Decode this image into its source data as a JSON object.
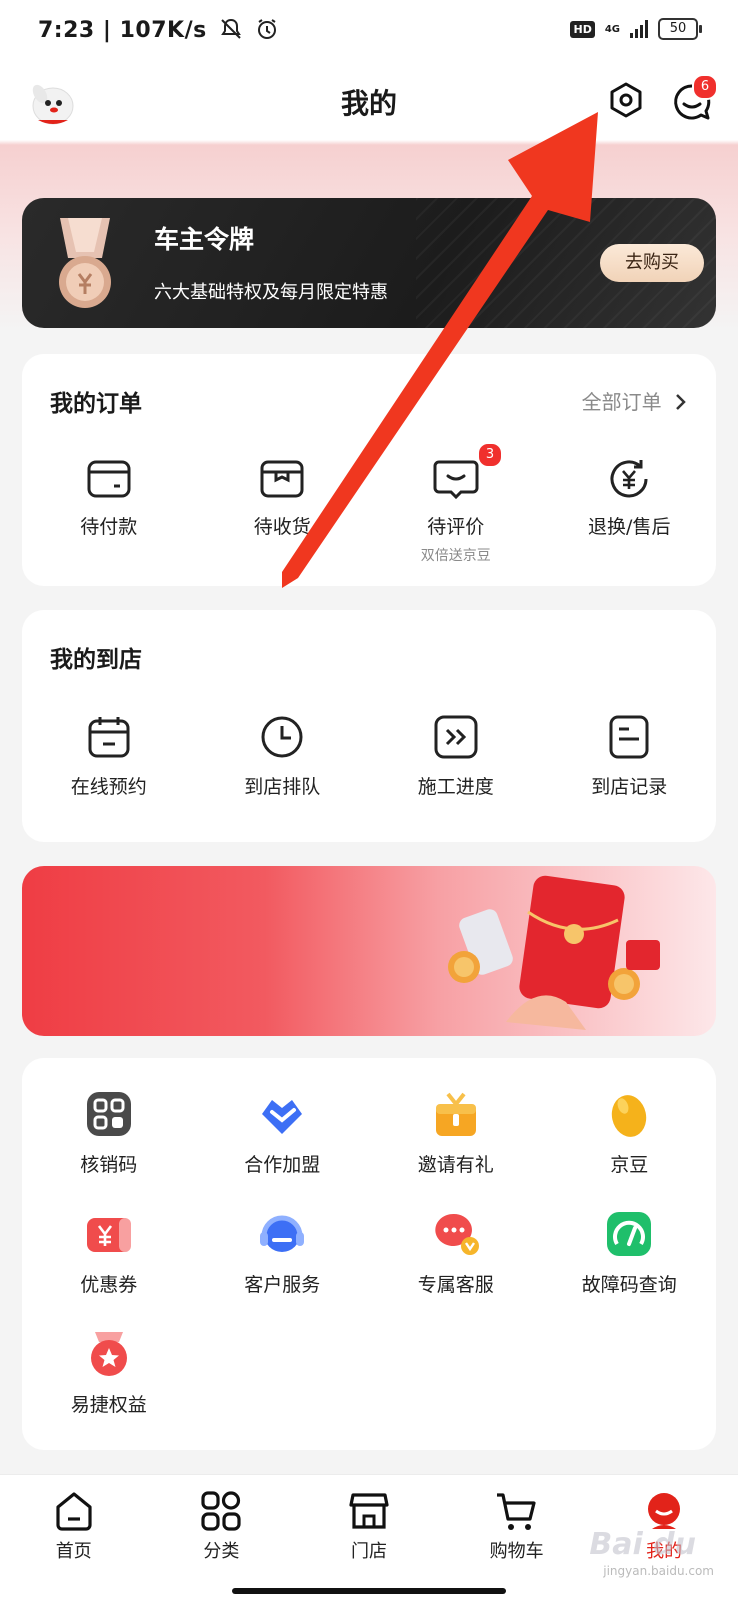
{
  "status_bar": {
    "time": "7:23",
    "speed": "107K/s",
    "hd": "HD",
    "network": "4G",
    "battery": "50"
  },
  "header": {
    "title": "我的",
    "message_badge": "6"
  },
  "vip": {
    "title": "车主令牌",
    "subtitle": "六大基础特权及每月限定特惠",
    "button": "去购买"
  },
  "orders": {
    "title": "我的订单",
    "all_link": "全部订单",
    "items": [
      {
        "label": "待付款",
        "icon": "wallet-icon"
      },
      {
        "label": "待收货",
        "icon": "package-icon"
      },
      {
        "label": "待评价",
        "icon": "review-icon",
        "badge": "3",
        "sub": "双倍送京豆"
      },
      {
        "label": "退换/售后",
        "icon": "refund-icon"
      }
    ]
  },
  "store": {
    "title": "我的到店",
    "items": [
      {
        "label": "在线预约",
        "icon": "calendar-icon"
      },
      {
        "label": "到店排队",
        "icon": "clock-icon"
      },
      {
        "label": "施工进度",
        "icon": "progress-icon"
      },
      {
        "label": "到店记录",
        "icon": "record-icon"
      }
    ]
  },
  "services": {
    "items": [
      {
        "label": "核销码",
        "icon": "qr-code-icon",
        "color": "#555555"
      },
      {
        "label": "合作加盟",
        "icon": "handshake-icon",
        "color": "#3d6ff5"
      },
      {
        "label": "邀请有礼",
        "icon": "gift-icon",
        "color": "#f6a623"
      },
      {
        "label": "京豆",
        "icon": "bean-icon",
        "color": "#f5b21b"
      },
      {
        "label": "优惠券",
        "icon": "coupon-icon",
        "color": "#f04c4c"
      },
      {
        "label": "客户服务",
        "icon": "headset-icon",
        "color": "#3d6ff5"
      },
      {
        "label": "专属客服",
        "icon": "chat-vip-icon",
        "color": "#f04c4c"
      },
      {
        "label": "故障码查询",
        "icon": "fault-code-icon",
        "color": "#1fbf6b"
      },
      {
        "label": "易捷权益",
        "icon": "medal-icon",
        "color": "#f04c4c"
      }
    ]
  },
  "tabbar": {
    "items": [
      {
        "label": "首页",
        "icon": "home-icon"
      },
      {
        "label": "分类",
        "icon": "category-icon"
      },
      {
        "label": "门店",
        "icon": "store-icon"
      },
      {
        "label": "购物车",
        "icon": "cart-icon"
      },
      {
        "label": "我的",
        "icon": "profile-mascot-icon",
        "active": true
      }
    ]
  },
  "colors": {
    "accent": "#e2231a",
    "annotation_arrow": "#f0371f"
  },
  "watermark": {
    "brand": "Bai du",
    "site": "jingyan.baidu.com"
  }
}
